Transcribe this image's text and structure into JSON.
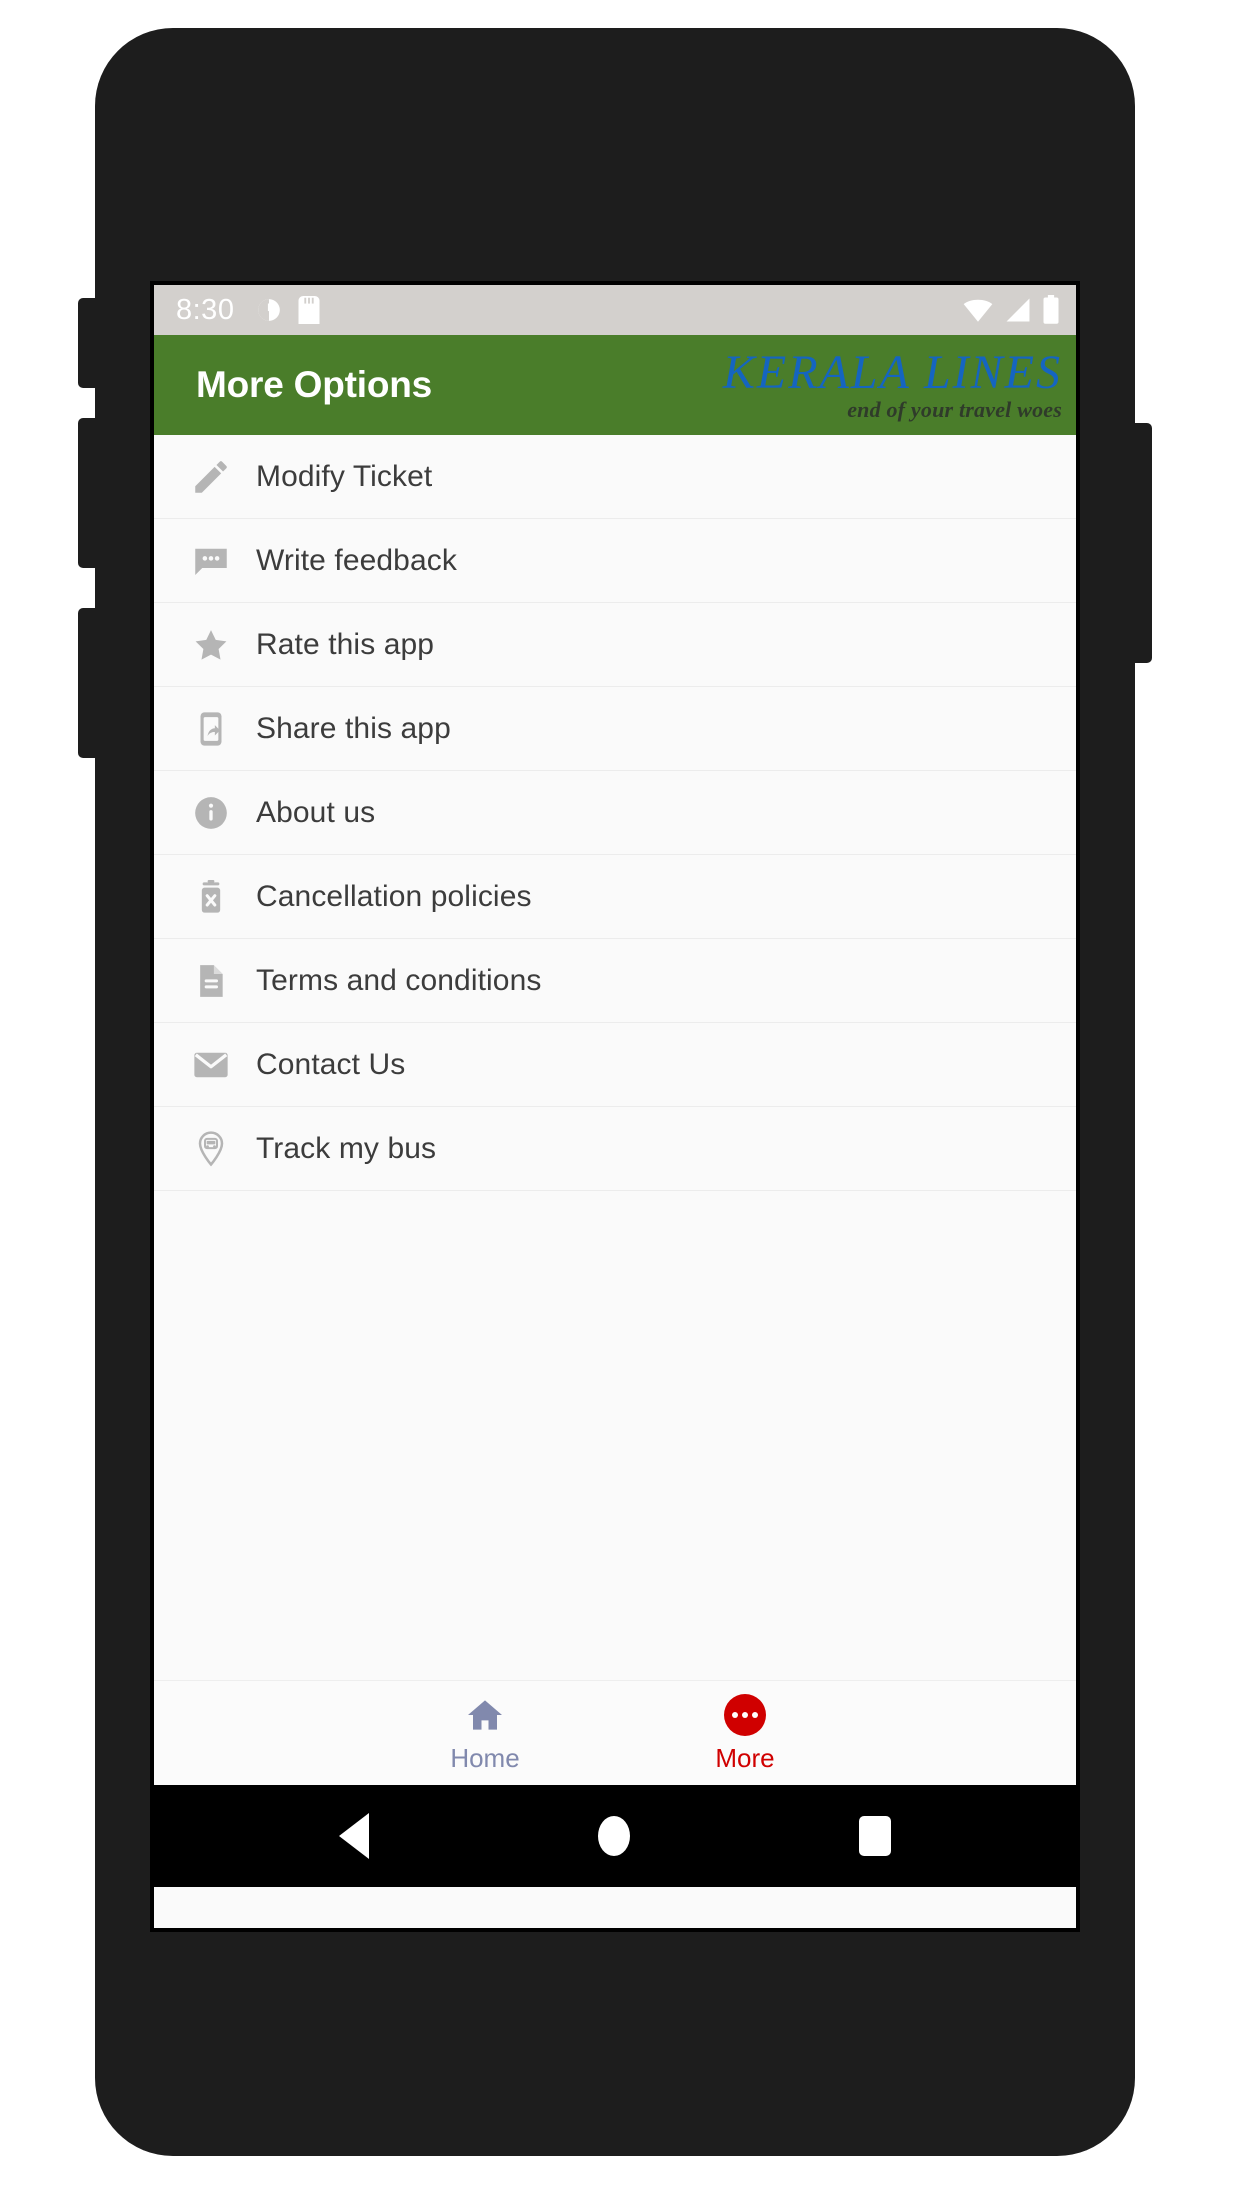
{
  "device": {
    "frame_color": "#1d1d1d",
    "buttons": [
      "volume-up",
      "volume-down",
      "extra-key",
      "power"
    ]
  },
  "statusbar": {
    "time": "8:30",
    "left_icons": [
      "alarm-clock-icon",
      "sd-card-icon"
    ],
    "right_icons": [
      "wifi-icon",
      "cellular-signal-icon",
      "battery-icon"
    ],
    "background": "#d3d0cd"
  },
  "appbar": {
    "title": "More Options",
    "background": "#4a7d2a",
    "brand": {
      "name": "KERALA LINES",
      "tagline": "end of your travel woes",
      "name_color": "#1565c0",
      "tagline_color": "#2f3b2a"
    }
  },
  "menu": {
    "items": [
      {
        "label": "Modify Ticket",
        "icon": "pencil-icon"
      },
      {
        "label": "Write feedback",
        "icon": "chat-bubble-icon"
      },
      {
        "label": "Rate this app",
        "icon": "star-icon"
      },
      {
        "label": "Share this app",
        "icon": "phone-share-icon"
      },
      {
        "label": "About us",
        "icon": "info-icon"
      },
      {
        "label": "Cancellation policies",
        "icon": "trash-cancel-icon"
      },
      {
        "label": "Terms and conditions",
        "icon": "document-icon"
      },
      {
        "label": "Contact Us",
        "icon": "envelope-icon"
      },
      {
        "label": "Track my bus",
        "icon": "map-pin-bus-icon"
      }
    ],
    "icon_color": "#b5b5b5",
    "text_color": "#3c3c3c"
  },
  "bottomnav": {
    "tabs": [
      {
        "label": "Home",
        "icon": "home-icon",
        "active": false,
        "color": "#8189ad"
      },
      {
        "label": "More",
        "icon": "more-dots-icon",
        "active": true,
        "color": "#d00000"
      }
    ]
  },
  "androidnav": {
    "buttons": [
      "back-triangle-icon",
      "home-circle-icon",
      "recents-square-icon"
    ],
    "background": "#000000"
  }
}
